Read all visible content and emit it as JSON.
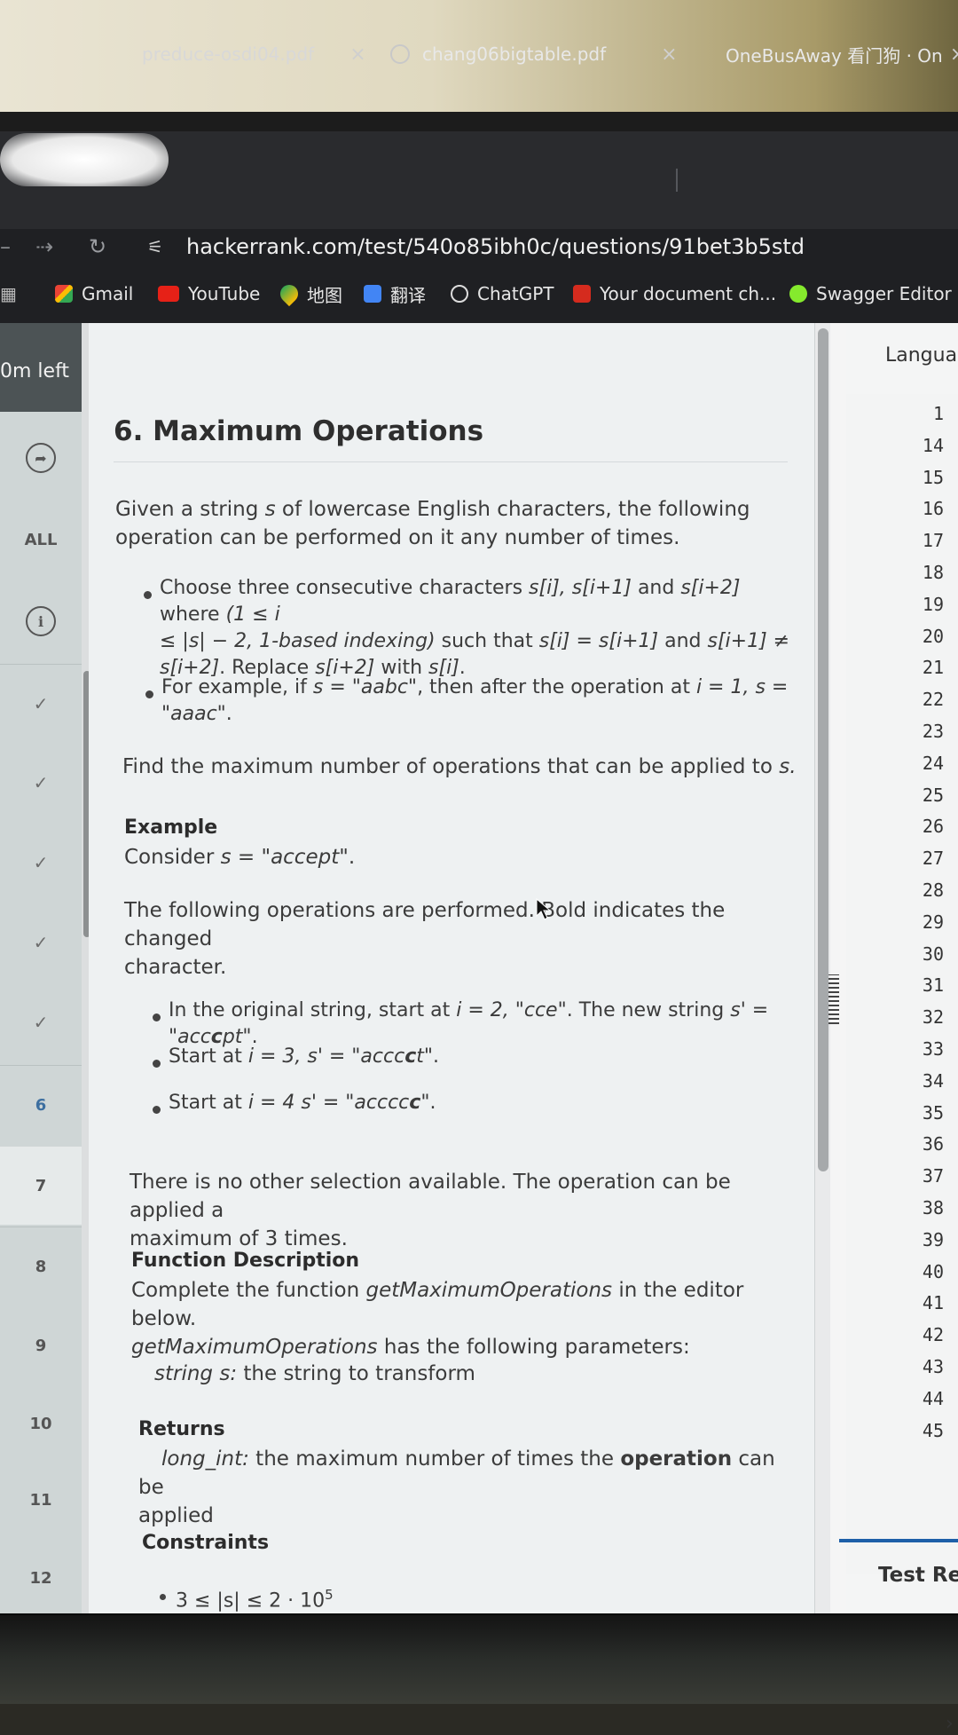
{
  "browser": {
    "tabs": [
      {
        "title": "preduce-osdi04.pdf",
        "close": "×"
      },
      {
        "title": "chang06bigtable.pdf",
        "close": "×"
      },
      {
        "title": "OneBusAway 看门狗 · On",
        "close": "×"
      }
    ],
    "url": "hackerrank.com/test/540o85ibh0c/questions/91bet3b5std",
    "bookmarks": [
      "Gmail",
      "YouTube",
      "地图",
      "翻译",
      "ChatGPT",
      "Your document ch...",
      "Swagger Editor"
    ]
  },
  "sidebar": {
    "timer": "0m left",
    "all_label": "ALL",
    "check_glyph": "✓",
    "info_glyph": "i",
    "flag_glyph": "➦",
    "items": [
      "6",
      "7",
      "8",
      "9",
      "10",
      "11",
      "12"
    ]
  },
  "question": {
    "title": "6. Maximum Operations",
    "intro_1": "Given a string ",
    "intro_var": "s",
    "intro_2": " of lowercase English characters, the following",
    "intro_3": "operation can be performed on it any number of times.",
    "rule_a": "Choose three consecutive characters ",
    "rule_b": "s[i], s[i+1]",
    "rule_c": " and ",
    "rule_d": "s[i+2]",
    "rule_e": " where ",
    "rule_f": "(1 ≤ i",
    "rule_g": "≤ |s| − 2, 1-based indexing)",
    "rule_h": " such that ",
    "rule_i": "s[i] = s[i+1]",
    "rule_j": " and ",
    "rule_k": "s[i+1] ≠",
    "rule_l": "s[i+2]",
    "rule_m": ". Replace ",
    "rule_n": "s[i+2]",
    "rule_o": " with ",
    "rule_p": "s[i]",
    "rule_q": ".",
    "ex_a": "For example, if ",
    "ex_b": "s = \"aabc\"",
    "ex_c": ", then after the operation at ",
    "ex_d": "i = 1, s = \"aaac\"",
    "ex_e": ".",
    "find_a": "Find the maximum number of operations that can be applied to ",
    "find_b": "s.",
    "example_heading": "Example",
    "consider_a": "Consider ",
    "consider_b": "s = \"accept\"",
    "consider_c": ".",
    "ops_1": "The following operations are performed. Bold indicates the changed",
    "ops_2": "character.",
    "step1_a": "In the original string, start at ",
    "step1_b": "i = 2, \"cce\"",
    "step1_c": ". The new string ",
    "step1_d": "s' = \"acc",
    "step1_e": "c",
    "step1_f": "pt\"",
    "step1_g": ".",
    "step2_a": "Start at ",
    "step2_b": "i = 3, s' = \"accc",
    "step2_c": "c",
    "step2_d": "t\"",
    "step2_e": ".",
    "step3_a": "Start at ",
    "step3_b": "i = 4 s' = \"acccc",
    "step3_c": "c",
    "step3_d": "\"",
    "step3_e": ".",
    "noother_1": "There is no other selection available.  The operation can be applied a",
    "noother_2": "maximum of 3 times.",
    "func_heading": "Function Description",
    "func_a": "Complete the function ",
    "func_b": "getMaximumOperations",
    "func_c": " in the editor below.",
    "params_a": "getMaximumOperations",
    "params_b": " has the following parameters:",
    "param_a": "string s:",
    "param_b": "  the string to transform",
    "returns_heading": "Returns",
    "ret_a": "long_int:",
    "ret_b": " the maximum number of times the ",
    "ret_c": "operation",
    "ret_d": " can be",
    "ret_e": "applied",
    "constraints_heading": "Constraints",
    "constraint_1a": "3 ≤ |s| ≤ 2 · 10",
    "constraint_1b": "5"
  },
  "editor": {
    "language_label": "Languag",
    "line_numbers": [
      "1",
      "14",
      "15",
      "16",
      "17",
      "18",
      "19",
      "20",
      "21",
      "22",
      "23",
      "24",
      "25",
      "26",
      "27",
      "28",
      "29",
      "30",
      "31",
      "32",
      "33",
      "34",
      "35",
      "36",
      "37",
      "38",
      "39",
      "40",
      "41",
      "42",
      "43",
      "44",
      "45"
    ],
    "chevron": "›",
    "test_results": "Test Re"
  }
}
